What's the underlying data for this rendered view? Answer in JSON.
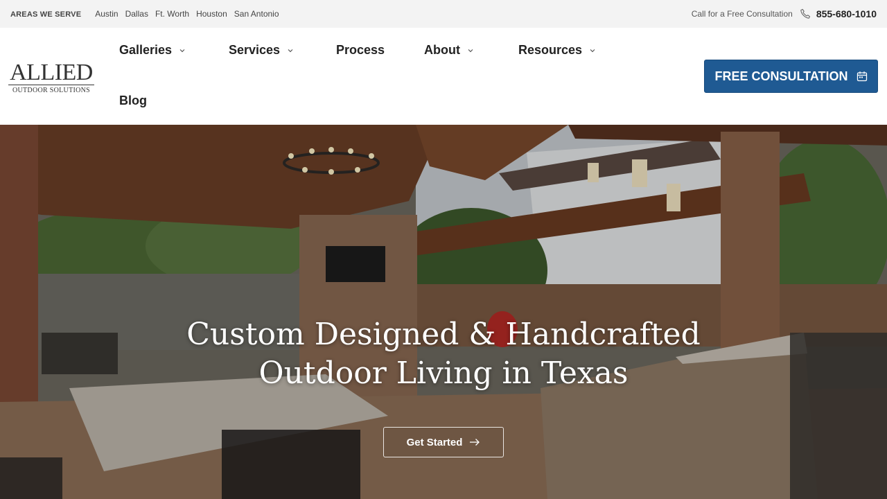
{
  "topbar": {
    "areas_label": "AREAS WE SERVE",
    "areas": [
      "Austin",
      "Dallas",
      "Ft. Worth",
      "Houston",
      "San Antonio"
    ],
    "contact_label": "Call for a Free Consultation",
    "phone": "855-680-1010",
    "phone_icon": "phone-icon"
  },
  "logo": {
    "main": "ALLIED",
    "sub": "OUTDOOR SOLUTIONS"
  },
  "nav": {
    "galleries": "Galleries",
    "services": "Services",
    "process": "Process",
    "about": "About",
    "resources": "Resources",
    "blog": "Blog"
  },
  "cta": {
    "label": "FREE CONSULTATION",
    "icon": "calendar-icon",
    "color": "#1f5a93"
  },
  "hero": {
    "title_line1": "Custom Designed & Handcrafted",
    "title_line2": "Outdoor Living in Texas",
    "button_label": "Get Started",
    "button_icon": "arrow-right-icon"
  }
}
